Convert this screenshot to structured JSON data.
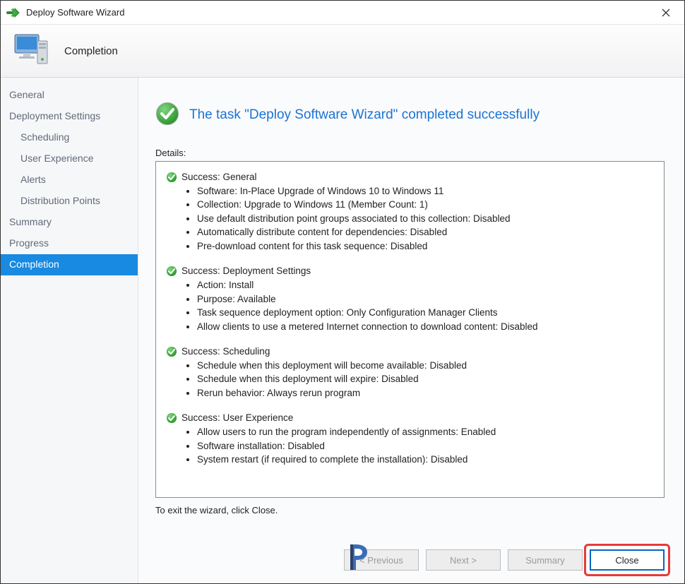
{
  "titlebar": {
    "title": "Deploy Software Wizard"
  },
  "header": {
    "page_name": "Completion"
  },
  "sidebar": {
    "items": [
      {
        "label": "General",
        "sub": false,
        "selected": false
      },
      {
        "label": "Deployment Settings",
        "sub": false,
        "selected": false
      },
      {
        "label": "Scheduling",
        "sub": true,
        "selected": false
      },
      {
        "label": "User Experience",
        "sub": true,
        "selected": false
      },
      {
        "label": "Alerts",
        "sub": true,
        "selected": false
      },
      {
        "label": "Distribution Points",
        "sub": true,
        "selected": false
      },
      {
        "label": "Summary",
        "sub": false,
        "selected": false
      },
      {
        "label": "Progress",
        "sub": false,
        "selected": false
      },
      {
        "label": "Completion",
        "sub": false,
        "selected": true
      }
    ]
  },
  "content": {
    "headline": "The task \"Deploy Software Wizard\" completed successfully",
    "details_label": "Details:",
    "sections": [
      {
        "title": "Success: General",
        "items": [
          "Software: In-Place Upgrade of Windows 10 to Windows 11",
          "Collection: Upgrade to Windows 11 (Member Count: 1)",
          "Use default distribution point groups associated to this collection: Disabled",
          "Automatically distribute content for dependencies: Disabled",
          "Pre-download content for this task sequence: Disabled"
        ]
      },
      {
        "title": "Success: Deployment Settings",
        "items": [
          "Action: Install",
          "Purpose: Available",
          "Task sequence deployment option: Only Configuration Manager Clients",
          "Allow clients to use a metered Internet connection to download content: Disabled"
        ]
      },
      {
        "title": "Success: Scheduling",
        "items": [
          "Schedule when this deployment will become available: Disabled",
          "Schedule when this deployment will expire: Disabled",
          "Rerun behavior: Always rerun program"
        ]
      },
      {
        "title": "Success: User Experience",
        "items": [
          "Allow users to run the program independently of assignments: Enabled",
          "Software installation: Disabled",
          "System restart (if required to complete the installation): Disabled"
        ]
      }
    ],
    "exit_note": "To exit the wizard, click Close."
  },
  "buttons": {
    "previous": "< Previous",
    "next": "Next >",
    "summary": "Summary",
    "close": "Close"
  }
}
